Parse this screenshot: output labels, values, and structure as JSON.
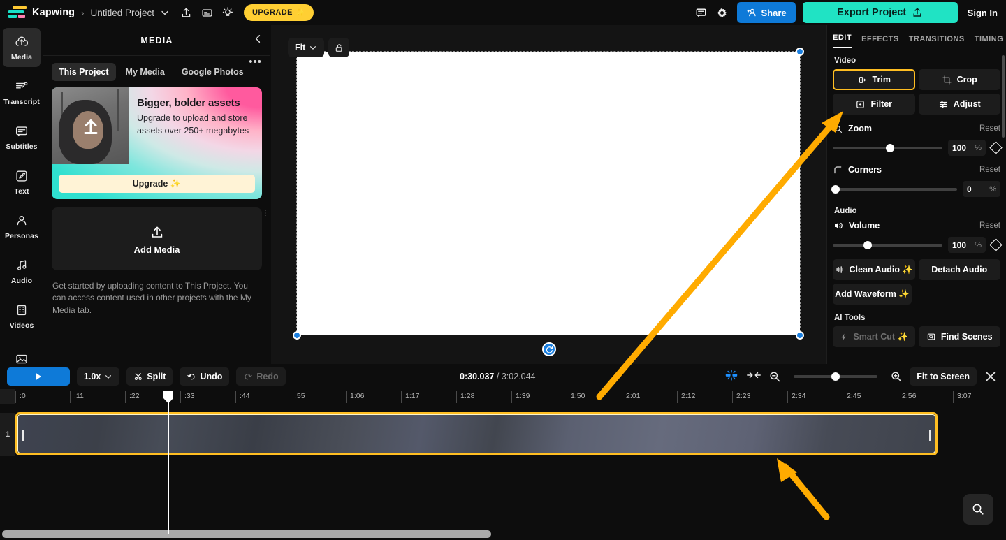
{
  "topbar": {
    "brand": "Kapwing",
    "separator": "›",
    "project_name": "Untitled Project",
    "project_caret": "⌄",
    "upgrade_label": "UPGRADE",
    "upgrade_sparkle": "✨",
    "share_label": "Share",
    "export_label": "Export Project",
    "signin_label": "Sign In",
    "icons": {
      "share_project": "upload-icon",
      "captions": "captions-icon",
      "tips": "lightbulb-icon",
      "comments": "comment-icon",
      "settings": "gear-icon"
    },
    "colors": {
      "upgrade_bg": "#ffcf33",
      "share_bg": "#0e7ad8",
      "export_bg": "#20e3c4"
    }
  },
  "rail": {
    "items": [
      {
        "label": "Media",
        "icon": "upload-cloud-icon",
        "active": true
      },
      {
        "label": "Transcript",
        "icon": "transcript-icon",
        "active": false
      },
      {
        "label": "Subtitles",
        "icon": "subtitles-icon",
        "active": false
      },
      {
        "label": "Text",
        "icon": "text-edit-icon",
        "active": false
      },
      {
        "label": "Personas",
        "icon": "person-icon",
        "active": false
      },
      {
        "label": "Audio",
        "icon": "music-note-icon",
        "active": false
      },
      {
        "label": "Videos",
        "icon": "film-strip-icon",
        "active": false
      },
      {
        "label": "",
        "icon": "image-icon",
        "active": false
      }
    ]
  },
  "media_panel": {
    "title": "MEDIA",
    "collapse_icon": "chevron-left-icon",
    "more_icon": "ellipsis-icon",
    "tabs": [
      {
        "label": "This Project",
        "active": true
      },
      {
        "label": "My Media",
        "active": false
      },
      {
        "label": "Google Photos",
        "active": false
      }
    ],
    "promo": {
      "heading": "Bigger, bolder assets",
      "body": "Upgrade to upload and store assets over 250+ megabytes",
      "cta": "Upgrade ✨"
    },
    "add_media_label": "Add Media",
    "add_media_icon": "upload-icon",
    "hint": "Get started by uploading content to This Project. You can access content used in other projects with the My Media tab."
  },
  "stage": {
    "fit_label": "Fit",
    "fit_caret": "⌄",
    "lock_icon": "unlock-icon",
    "rotate_icon": "rotate-icon"
  },
  "right_panel": {
    "tabs": [
      {
        "label": "EDIT",
        "active": true
      },
      {
        "label": "EFFECTS",
        "active": false
      },
      {
        "label": "TRANSITIONS",
        "active": false
      },
      {
        "label": "TIMING",
        "active": false
      }
    ],
    "video_section": {
      "label": "Video",
      "buttons": [
        {
          "label": "Trim",
          "icon": "trim-icon",
          "selected": true
        },
        {
          "label": "Crop",
          "icon": "crop-icon",
          "selected": false
        },
        {
          "label": "Filter",
          "icon": "filter-icon",
          "selected": false
        },
        {
          "label": "Adjust",
          "icon": "adjust-sliders-icon",
          "selected": false
        }
      ],
      "zoom": {
        "label": "Zoom",
        "icon": "magnifier-icon",
        "reset": "Reset",
        "value": "100",
        "unit": "%",
        "slider_pct": 52
      },
      "corners": {
        "label": "Corners",
        "icon": "corner-radius-icon",
        "reset": "Reset",
        "value": "0",
        "unit": "%",
        "slider_pct": 0
      }
    },
    "audio_section": {
      "label": "Audio",
      "volume": {
        "label": "Volume",
        "icon": "speaker-icon",
        "reset": "Reset",
        "value": "100",
        "unit": "%",
        "slider_pct": 32
      },
      "buttons": [
        {
          "label": "Clean Audio ✨",
          "icon": "waveform-icon"
        },
        {
          "label": "Detach Audio",
          "icon": ""
        },
        {
          "label": "Add Waveform ✨",
          "icon": ""
        }
      ]
    },
    "ai_section": {
      "label": "AI Tools",
      "buttons": [
        {
          "label": "Smart Cut ✨",
          "icon": "bolt-icon",
          "disabled": true
        },
        {
          "label": "Find Scenes",
          "icon": "scene-search-icon",
          "disabled": false
        }
      ]
    },
    "accent_color": "#ffbe22"
  },
  "timeline": {
    "play_icon": "play-icon",
    "speed_label": "1.0x",
    "speed_caret": "⌄",
    "split_label": "Split",
    "split_icon": "scissors-icon",
    "undo_label": "Undo",
    "undo_icon": "undo-icon",
    "redo_label": "Redo",
    "redo_icon": "redo-icon",
    "current_time": "0:30.037",
    "time_separator": "/",
    "total_time": "3:02.044",
    "magnet_icon": "snap-magnet-icon",
    "fit_clips_icon": "fit-clips-icon",
    "zoom_out_icon": "zoom-out-icon",
    "zoom_in_icon": "zoom-in-icon",
    "zoom_slider_pct": 50,
    "fit_to_screen_label": "Fit to Screen",
    "close_icon": "close-icon",
    "track_number": "1",
    "ruler_ticks": [
      ":0",
      ":11",
      ":22",
      ":33",
      ":44",
      ":55",
      "1:06",
      "1:17",
      "1:28",
      "1:39",
      "1:50",
      "2:01",
      "2:12",
      "2:23",
      "2:34",
      "2:45",
      "2:56",
      "3:07"
    ],
    "search_icon": "search-icon"
  }
}
